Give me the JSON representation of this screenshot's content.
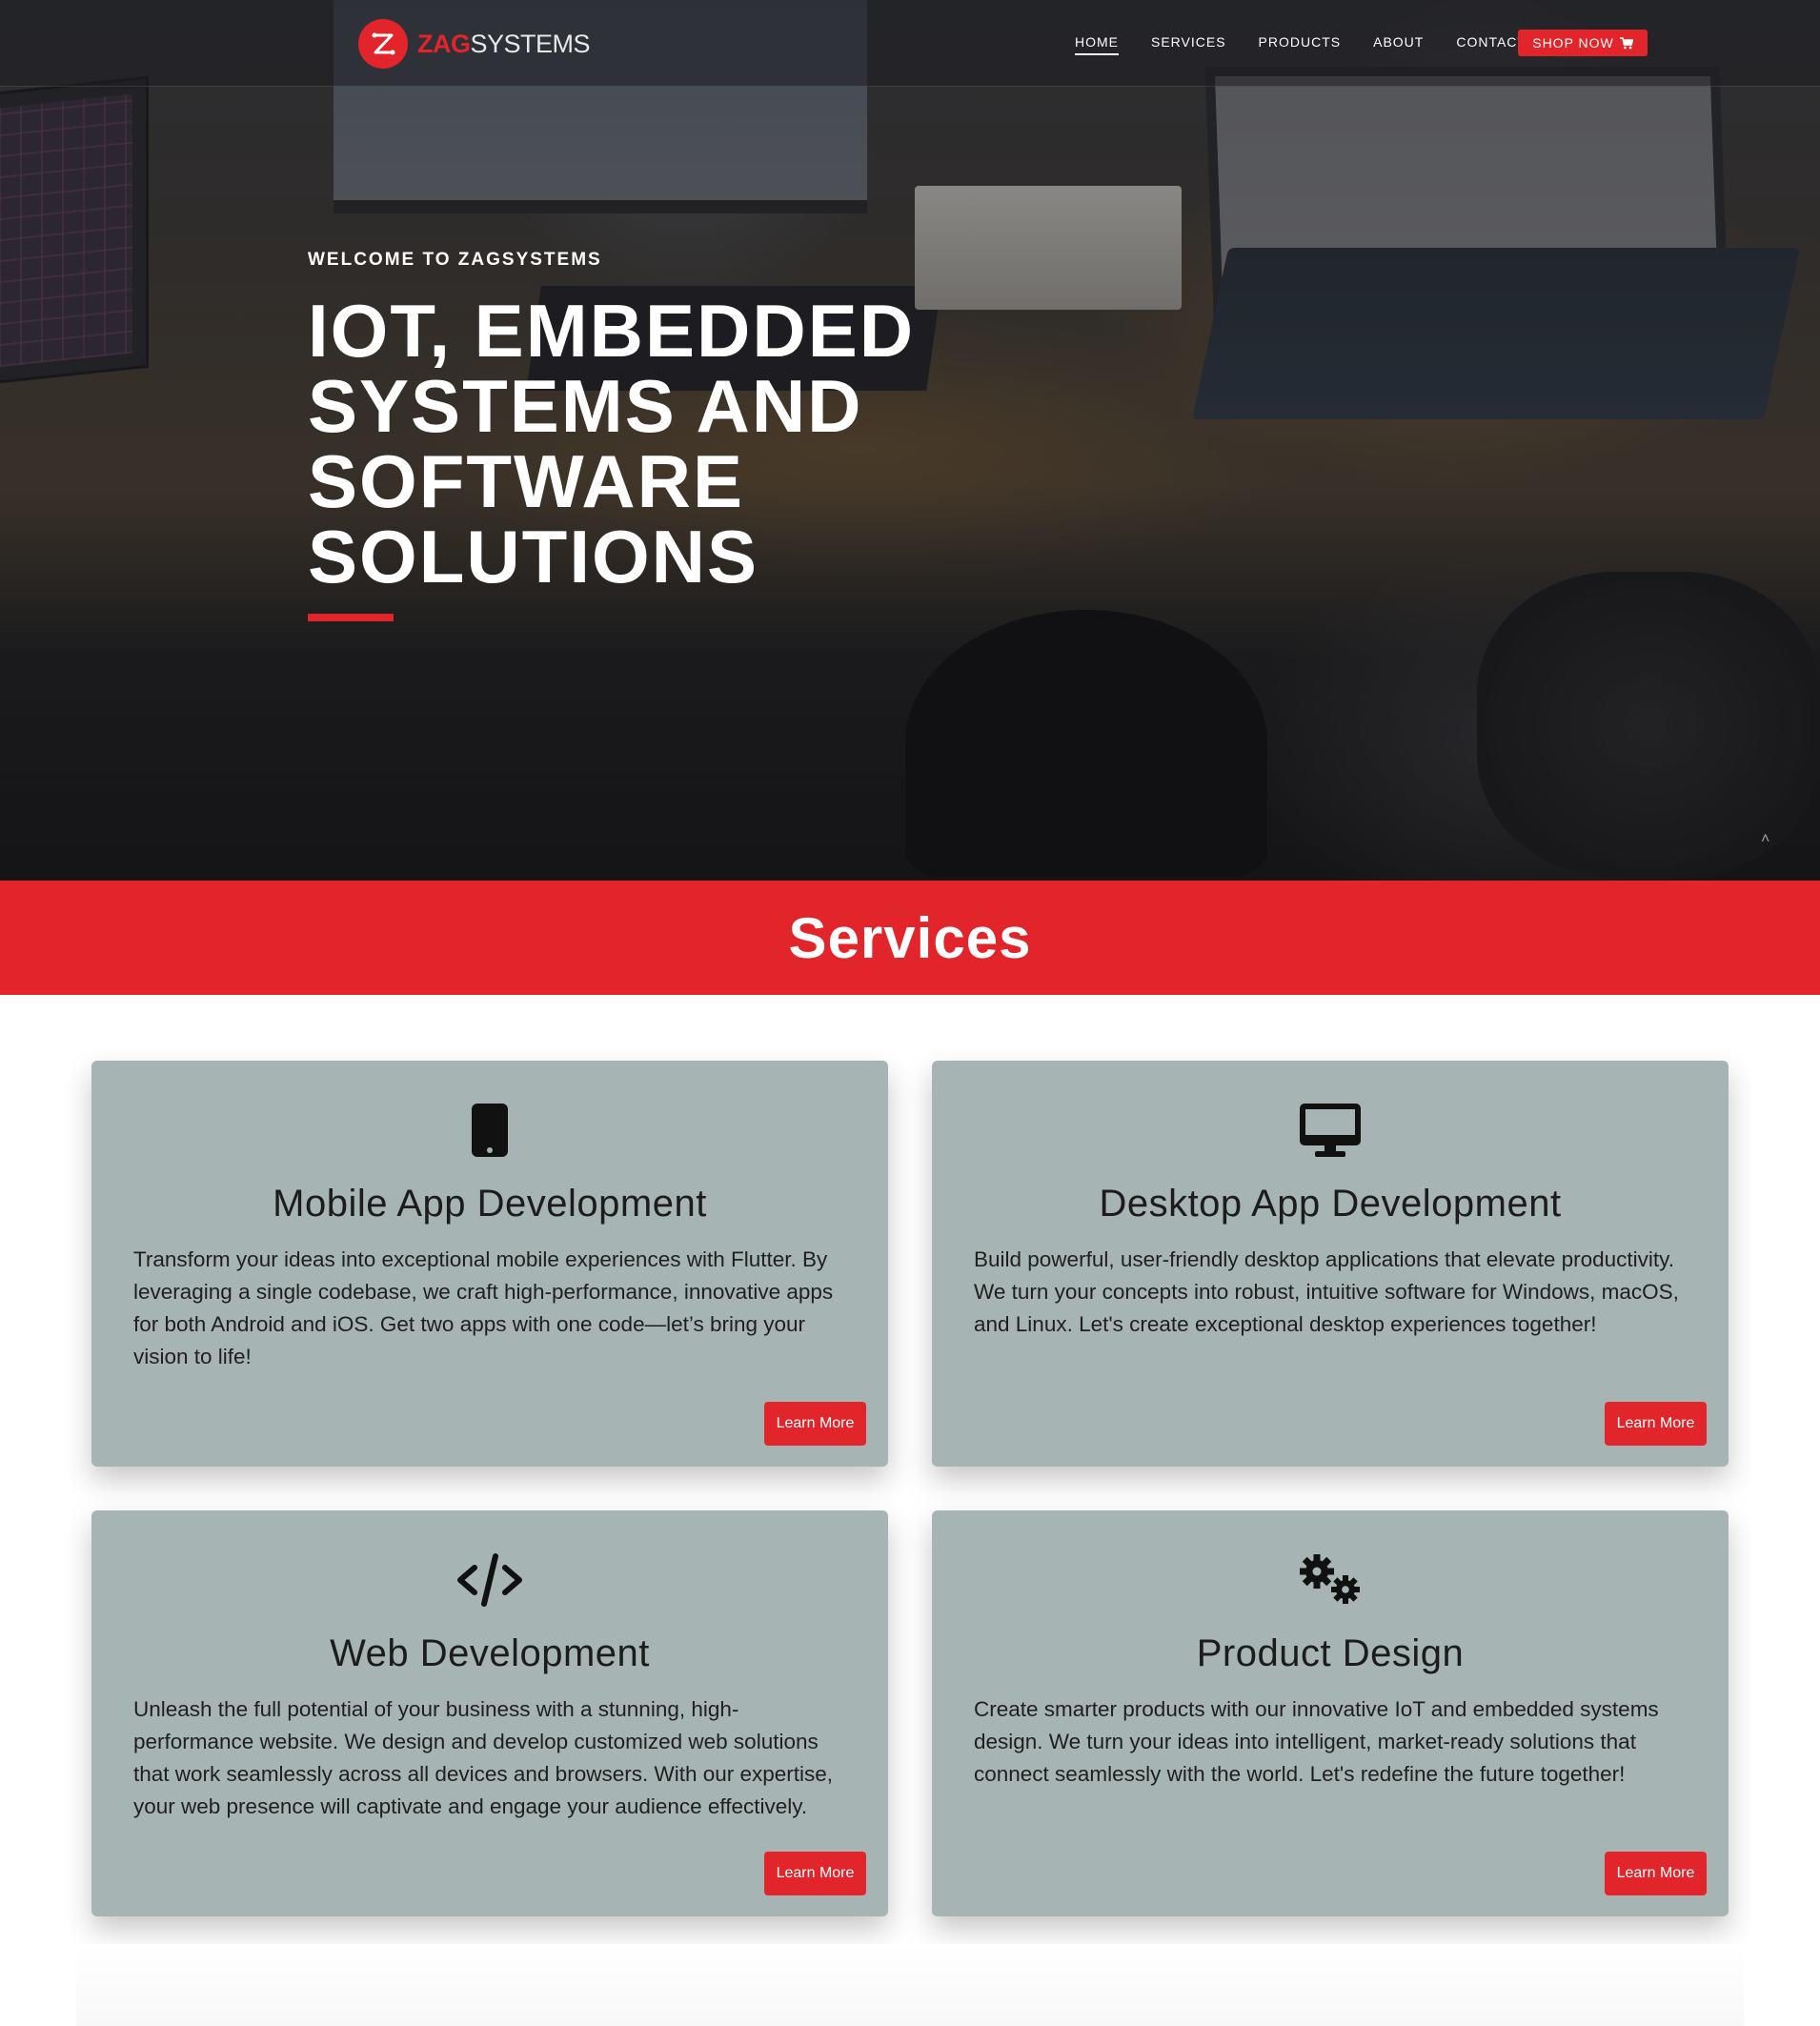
{
  "nav": {
    "logo_zag": "ZAG",
    "logo_systems": "SYSTEMS",
    "items": [
      {
        "label": "HOME",
        "active": true
      },
      {
        "label": "SERVICES"
      },
      {
        "label": "PRODUCTS"
      },
      {
        "label": "ABOUT"
      },
      {
        "label": "CONTACT"
      }
    ],
    "shop_label": "SHOP NOW"
  },
  "hero": {
    "welcome": "WELCOME TO ZAGSYSTEMS",
    "title": "IOT, EMBEDDED SYSTEMS AND SOFTWARE SOLUTIONS",
    "scroll_up_icon": "chevron-up-icon"
  },
  "services": {
    "title": "Services",
    "cards": [
      {
        "icon": "mobile-phone-icon",
        "title": "Mobile App Development",
        "description": "Transform your ideas into exceptional mobile experiences with Flutter. By leveraging a single codebase, we craft high-performance, innovative apps for both Android and iOS. Get two apps with one code—let’s bring your vision to life!",
        "button": "Learn More"
      },
      {
        "icon": "desktop-monitor-icon",
        "title": "Desktop App Development",
        "description": "Build powerful, user-friendly desktop applications that elevate productivity. We turn your concepts into robust, intuitive software for Windows, macOS, and Linux. Let's create exceptional desktop experiences together!",
        "button": "Learn More"
      },
      {
        "icon": "code-icon",
        "title": "Web Development",
        "description": "Unleash the full potential of your business with a stunning, high-performance website. We design and develop customized web solutions that work seamlessly across all devices and browsers. With our expertise, your web presence will captivate and engage your audience effectively.",
        "button": "Learn More"
      },
      {
        "icon": "gears-icon",
        "title": "Product Design",
        "description": "Create smarter products with our innovative IoT and embedded systems design. We turn your ideas into intelligent, market-ready solutions that connect seamlessly with the world. Let's redefine the future together!",
        "button": "Learn More"
      }
    ]
  },
  "colors": {
    "accent": "#e1252b",
    "card_bg": "#a7b4b4"
  }
}
